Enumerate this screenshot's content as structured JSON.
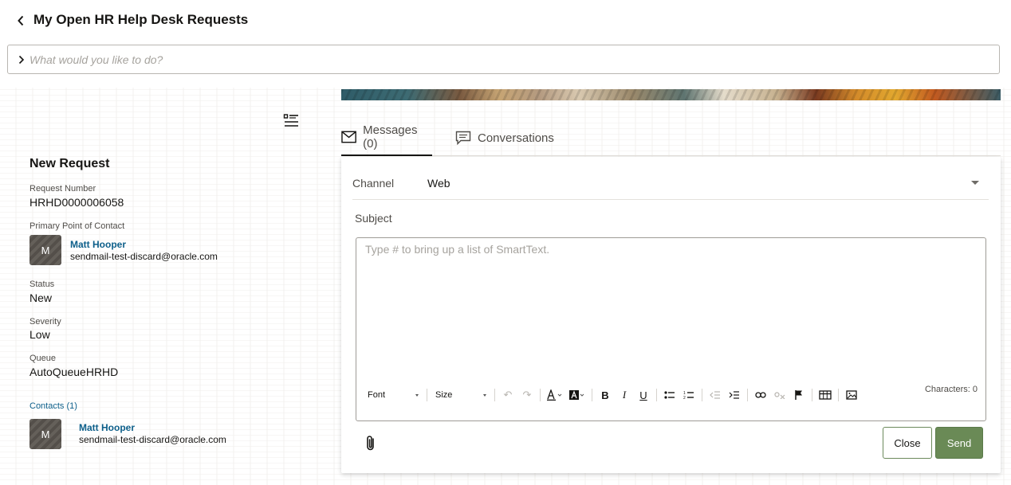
{
  "header": {
    "title": "My Open HR Help Desk Requests"
  },
  "search": {
    "placeholder": "What would you like to do?"
  },
  "request": {
    "title": "New Request",
    "number_label": "Request Number",
    "number": "HRHD0000006058",
    "poc_label": "Primary Point of Contact",
    "poc": {
      "initial": "M",
      "name": "Matt Hooper",
      "email": "sendmail-test-discard@oracle.com"
    },
    "status_label": "Status",
    "status": "New",
    "severity_label": "Severity",
    "severity": "Low",
    "queue_label": "Queue",
    "queue": "AutoQueueHRHD",
    "contacts_label": "Contacts (1)",
    "contacts": [
      {
        "initial": "M",
        "name": "Matt Hooper",
        "email": "sendmail-test-discard@oracle.com"
      }
    ]
  },
  "tabs": [
    {
      "label": "Messages (0)",
      "icon": "envelope-icon",
      "active": true
    },
    {
      "label": "Conversations",
      "icon": "chat-bubble-icon",
      "active": false
    }
  ],
  "compose": {
    "channel_label": "Channel",
    "channel_value": "Web",
    "subject_label": "Subject",
    "editor_placeholder": "Type # to bring up a list of SmartText.",
    "font_label": "Font",
    "size_label": "Size",
    "char_count": "Characters: 0",
    "close_label": "Close",
    "send_label": "Send"
  },
  "colors": {
    "link": "#0d5f8a",
    "send_button": "#6a8a56",
    "avatar": "#5b5650"
  }
}
